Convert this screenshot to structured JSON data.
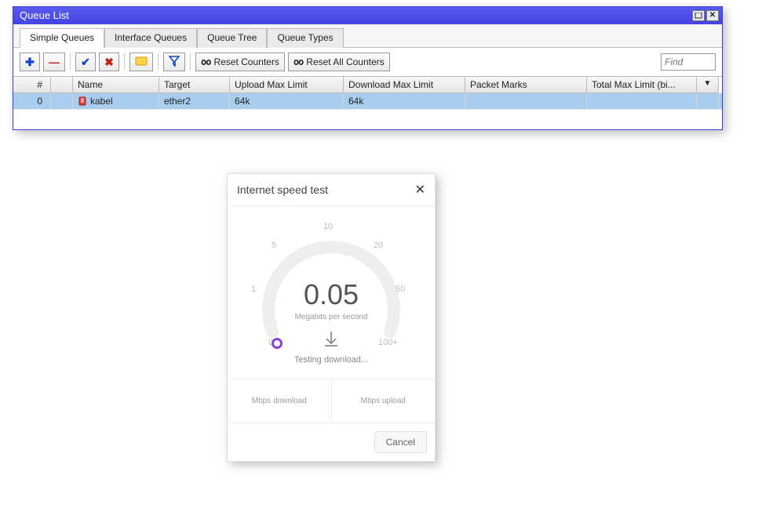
{
  "window": {
    "title": "Queue List",
    "tabs": [
      "Simple Queues",
      "Interface Queues",
      "Queue Tree",
      "Queue Types"
    ],
    "active_tab_index": 0,
    "toolbar": {
      "reset_counters": "Reset Counters",
      "reset_all_counters": "Reset All Counters",
      "find_placeholder": "Find",
      "counter_prefix": "oo",
      "counter_prefix2": "oo"
    },
    "grid": {
      "headers": {
        "num": "#",
        "name": "Name",
        "target": "Target",
        "upload": "Upload Max Limit",
        "download": "Download Max Limit",
        "packet_marks": "Packet Marks",
        "total": "Total Max Limit (bi...",
        "drop": "▼"
      },
      "rows": [
        {
          "num": "0",
          "name": "kabel",
          "target": "ether2",
          "upload": "64k",
          "download": "64k",
          "packet_marks": "",
          "total": ""
        }
      ]
    }
  },
  "speedtest": {
    "title": "Internet speed test",
    "value": "0.05",
    "unit": "Megabits per second",
    "status": "Testing download...",
    "ticks": {
      "t0": "0",
      "t1": "1",
      "t5": "5",
      "t10": "10",
      "t20": "20",
      "t50": "50",
      "t100": "100+"
    },
    "download_label": "Mbps download",
    "upload_label": "Mbps upload",
    "cancel": "Cancel"
  },
  "chart_data": {
    "type": "gauge",
    "title": "Internet speed test",
    "value": 0.05,
    "unit": "Megabits per second",
    "status": "Testing download...",
    "ticks": [
      0,
      1,
      5,
      10,
      20,
      50,
      100
    ],
    "range": [
      0,
      100
    ],
    "series": [
      {
        "name": "Mbps download",
        "value": null
      },
      {
        "name": "Mbps upload",
        "value": null
      }
    ]
  }
}
